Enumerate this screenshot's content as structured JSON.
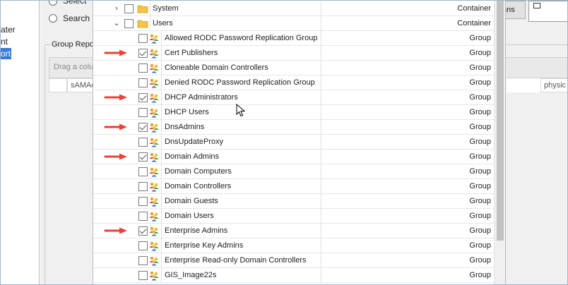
{
  "left_nav": {
    "items": [
      {
        "label": "ater",
        "selected": false
      },
      {
        "label": "nt",
        "selected": false
      },
      {
        "label": "ort",
        "selected": true
      }
    ]
  },
  "background": {
    "radio_partial_label": "Select",
    "radio_search_label": "Search",
    "group_box_title": "Group Repo",
    "drag_hint": "Drag a colu",
    "column_sam": "sAMAc",
    "column_physical": "physic",
    "right_button_partial": "nns"
  },
  "tree": {
    "containers": [
      {
        "name": "System",
        "type": "Container",
        "expanded": false
      },
      {
        "name": "Users",
        "type": "Container",
        "expanded": true
      }
    ],
    "groups": [
      {
        "name": "Allowed RODC Password Replication Group",
        "type": "Group",
        "checked": false
      },
      {
        "name": "Cert Publishers",
        "type": "Group",
        "checked": true
      },
      {
        "name": "Cloneable Domain Controllers",
        "type": "Group",
        "checked": false
      },
      {
        "name": "Denied RODC Password Replication Group",
        "type": "Group",
        "checked": false
      },
      {
        "name": "DHCP Administrators",
        "type": "Group",
        "checked": true
      },
      {
        "name": "DHCP Users",
        "type": "Group",
        "checked": false
      },
      {
        "name": "DnsAdmins",
        "type": "Group",
        "checked": true
      },
      {
        "name": "DnsUpdateProxy",
        "type": "Group",
        "checked": false
      },
      {
        "name": "Domain Admins",
        "type": "Group",
        "checked": true
      },
      {
        "name": "Domain Computers",
        "type": "Group",
        "checked": false
      },
      {
        "name": "Domain Controllers",
        "type": "Group",
        "checked": false
      },
      {
        "name": "Domain Guests",
        "type": "Group",
        "checked": false
      },
      {
        "name": "Domain Users",
        "type": "Group",
        "checked": false
      },
      {
        "name": "Enterprise Admins",
        "type": "Group",
        "checked": true
      },
      {
        "name": "Enterprise Key Admins",
        "type": "Group",
        "checked": false
      },
      {
        "name": "Enterprise Read-only Domain Controllers",
        "type": "Group",
        "checked": false
      },
      {
        "name": "GIS_Image22s",
        "type": "Group",
        "checked": false
      }
    ]
  },
  "icons": {
    "folder": "folder-icon",
    "group": "group-icon",
    "annotation": "red-arrow-icon",
    "cursor": "mouse-cursor-icon"
  },
  "colors": {
    "selection": "#3a7bd5",
    "arrow": "#e8413a",
    "folder": "#f5c542"
  }
}
